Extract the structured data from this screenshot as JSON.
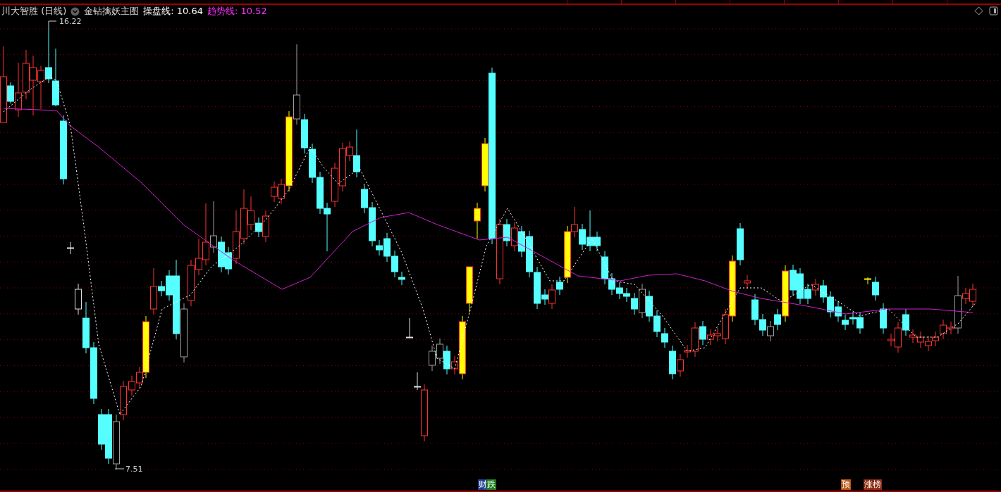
{
  "header": {
    "stock": "川大智胜 (日线)",
    "indicator": "金钻擒妖主图",
    "lines": [
      {
        "label": "操盘线: 10.64",
        "color": "#ffffff"
      },
      {
        "label": "趋势线: 10.52",
        "color": "#ff33ff"
      }
    ]
  },
  "chart": {
    "high_label": "16.22",
    "low_label": "7.51"
  },
  "bottom_tags": [
    {
      "label": "财",
      "color": "#1e3c8c"
    },
    {
      "label": "跌",
      "color": "#1e7a1e"
    },
    {
      "label": "预",
      "color": "#b5520f"
    },
    {
      "label": "涨榜",
      "color": "#8a2a10"
    }
  ]
}
